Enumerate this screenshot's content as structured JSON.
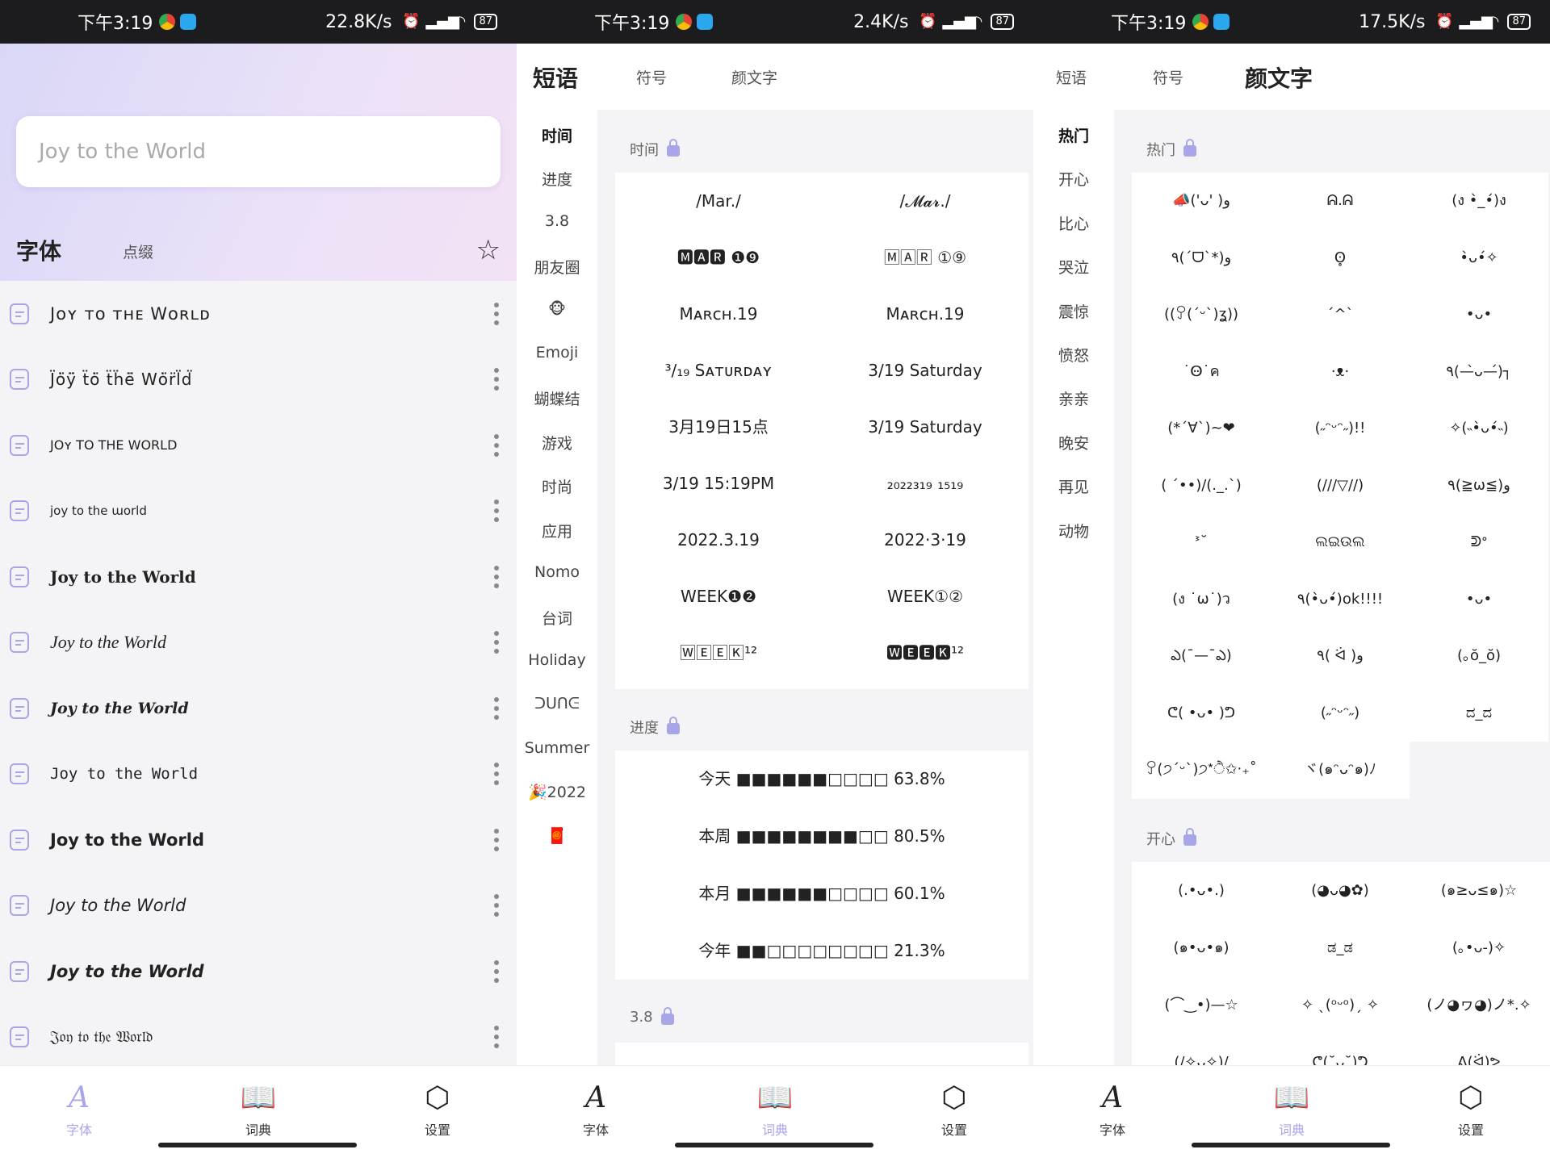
{
  "status": [
    {
      "time": "下午3:19",
      "speed": "22.8K/s",
      "battery": "87"
    },
    {
      "time": "下午3:19",
      "speed": "2.4K/s",
      "battery": "87"
    },
    {
      "time": "下午3:19",
      "speed": "17.5K/s",
      "battery": "87"
    }
  ],
  "fonts_screen": {
    "search_placeholder": "Joy to the World",
    "tabs": [
      "字体",
      "点缀"
    ],
    "star_icon": "star-outline-icon",
    "rows": [
      "Jᴏʏ ᴛᴏ ᴛʜᴇ Wᴏʀʟᴅ",
      "J̈ȯ̈ÿ̈ ẗȯ̈ ẗḧë̈ Wȯ̈r̈l̈d̈",
      "JOʏ TO THE WORLD",
      "joy to the ɯorld",
      "Joy to the World",
      "Joy to the World",
      "Joy to the World",
      "Joy to the World",
      "Joy to the World",
      "Joy to the World",
      "Joy to the World",
      "𝔍𝔬𝔶 𝔱𝔬 𝔱𝔥𝔢 𝔚𝔬𝔯𝔩𝔡"
    ]
  },
  "nav": {
    "font": "字体",
    "dict": "词典",
    "settings": "设置"
  },
  "phrases_screen": {
    "tabs": [
      "短语",
      "符号",
      "颜文字"
    ],
    "side": [
      "时间",
      "进度",
      "3.8",
      "朋友圈",
      "🐵",
      "Emoji",
      "蝴蝶结",
      "游戏",
      "时尚",
      "应用",
      "Nomo",
      "台词",
      "Holiday",
      "ᑐᑌᑎᕮ",
      "Summer",
      "🎉2022",
      "🧧"
    ],
    "sections": [
      {
        "title": "时间",
        "items": [
          "/Mar./",
          "/𝓜𝓪𝓻./",
          "🅼🅰🆁 ❶❾",
          "🄼🄰🅁 ①⑨",
          "Mᴀʀᴄʜ.19",
          "Mᴀʀᴄʜ.19",
          "³/₁₉ Sᴀᴛᴜʀᴅᴀʏ",
          "3/19 Saturday",
          "3月19日15点",
          "3/19 Saturday",
          "3/19 15:19PM",
          "₂₀₂₂₃₁₉ ₁₅₁₉",
          "2022.3.19",
          "2022·3·19",
          "WEEK❶❷",
          "WEEK①②",
          "🅆🄴🄴🄺¹²",
          "🆆🅴🅴🅺¹²"
        ]
      },
      {
        "title": "进度",
        "items": [
          "今天 ■■■■■■□□□□ 63.8%",
          "本周 ■■■■■■■■□□ 80.5%",
          "本月 ■■■■■■□□□□ 60.1%",
          "今年 ■■□□□□□□□□ 21.3%"
        ]
      },
      {
        "title": "3.8",
        "items": []
      }
    ]
  },
  "kaomoji_screen": {
    "tabs": [
      "短语",
      "符号",
      "颜文字"
    ],
    "side": [
      "热门",
      "开心",
      "比心",
      "哭泣",
      "震惊",
      "愤怒",
      "亲亲",
      "晚安",
      "再见",
      "动物"
    ],
    "sections": [
      {
        "title": "热门",
        "items": [
          "📣('ᴗ' )و",
          "ᕱ.ᕱ",
          "(ง •̀_•́)ง",
          "٩(ˊᗜˋ*)و",
          "ʘ̥",
          "•̀ᴗ•́✧",
          "((ꎤ(ˊᵕˋ)ʓ))",
          "ˊ^ˋ",
          "•ᴗ•",
          "˙Ꙫ˙ค",
          "·ᴥ·",
          "٩(—̀ᴗ—́)┐",
          "(*´∀`)~❤",
          "(˶ᵔᵕᵔ˶)!!",
          "✧(˵•̀ᴗ•́˵)",
          "( ´••)/(._.`)",
          "(///▽//)",
          "٩(≧ω≦)و",
          "ᕑ˘",
          "ଲଇଉଲ",
          "ᕲᐤ",
          "(ง ˙ω˙)ว",
          "٩(•̀ᴗ•́)ok!!!!",
          "•ᴗ•",
          "ఎ(¯—¯ఎ)",
          "٩( ᐛ )و",
          "(｡ŏ_ŏ)",
          "ᕦ( •ᴗ• )ᕤ",
          "(˶ᵔᵕᵔ˶)",
          "ದ_ದ",
          "ꎤ(੭ˊᵕˋ)੭*ੈ✩‧₊˚",
          "ヾ(๑ᵔᴗᵔ๑)ﾉ"
        ]
      },
      {
        "title": "开心",
        "items": [
          "(.•ᴗ•.)",
          "(◕ᴗ◕✿)",
          "(๑≥ᴗ≤๑)☆",
          "(๑•ᴗ•๑)",
          "ಡ_ಡ",
          "(｡•ᴗ-)✧",
          "(⌒‿•)—☆",
          "✧ ˎ(ᵒᵕᵒ)ˏ ✧",
          "(ノ◕ヮ◕)ノ*.✧",
          "(/✧ᴗ✧)/",
          "ᕦ(˘ᴗ˘)ᕤ",
          "ᕕ(ᐛ)ᕗ"
        ]
      }
    ]
  },
  "colors": {
    "accent": "#a9a4ee",
    "highlight": "#c4c0f2",
    "status_bar": "#1c1c1e"
  }
}
